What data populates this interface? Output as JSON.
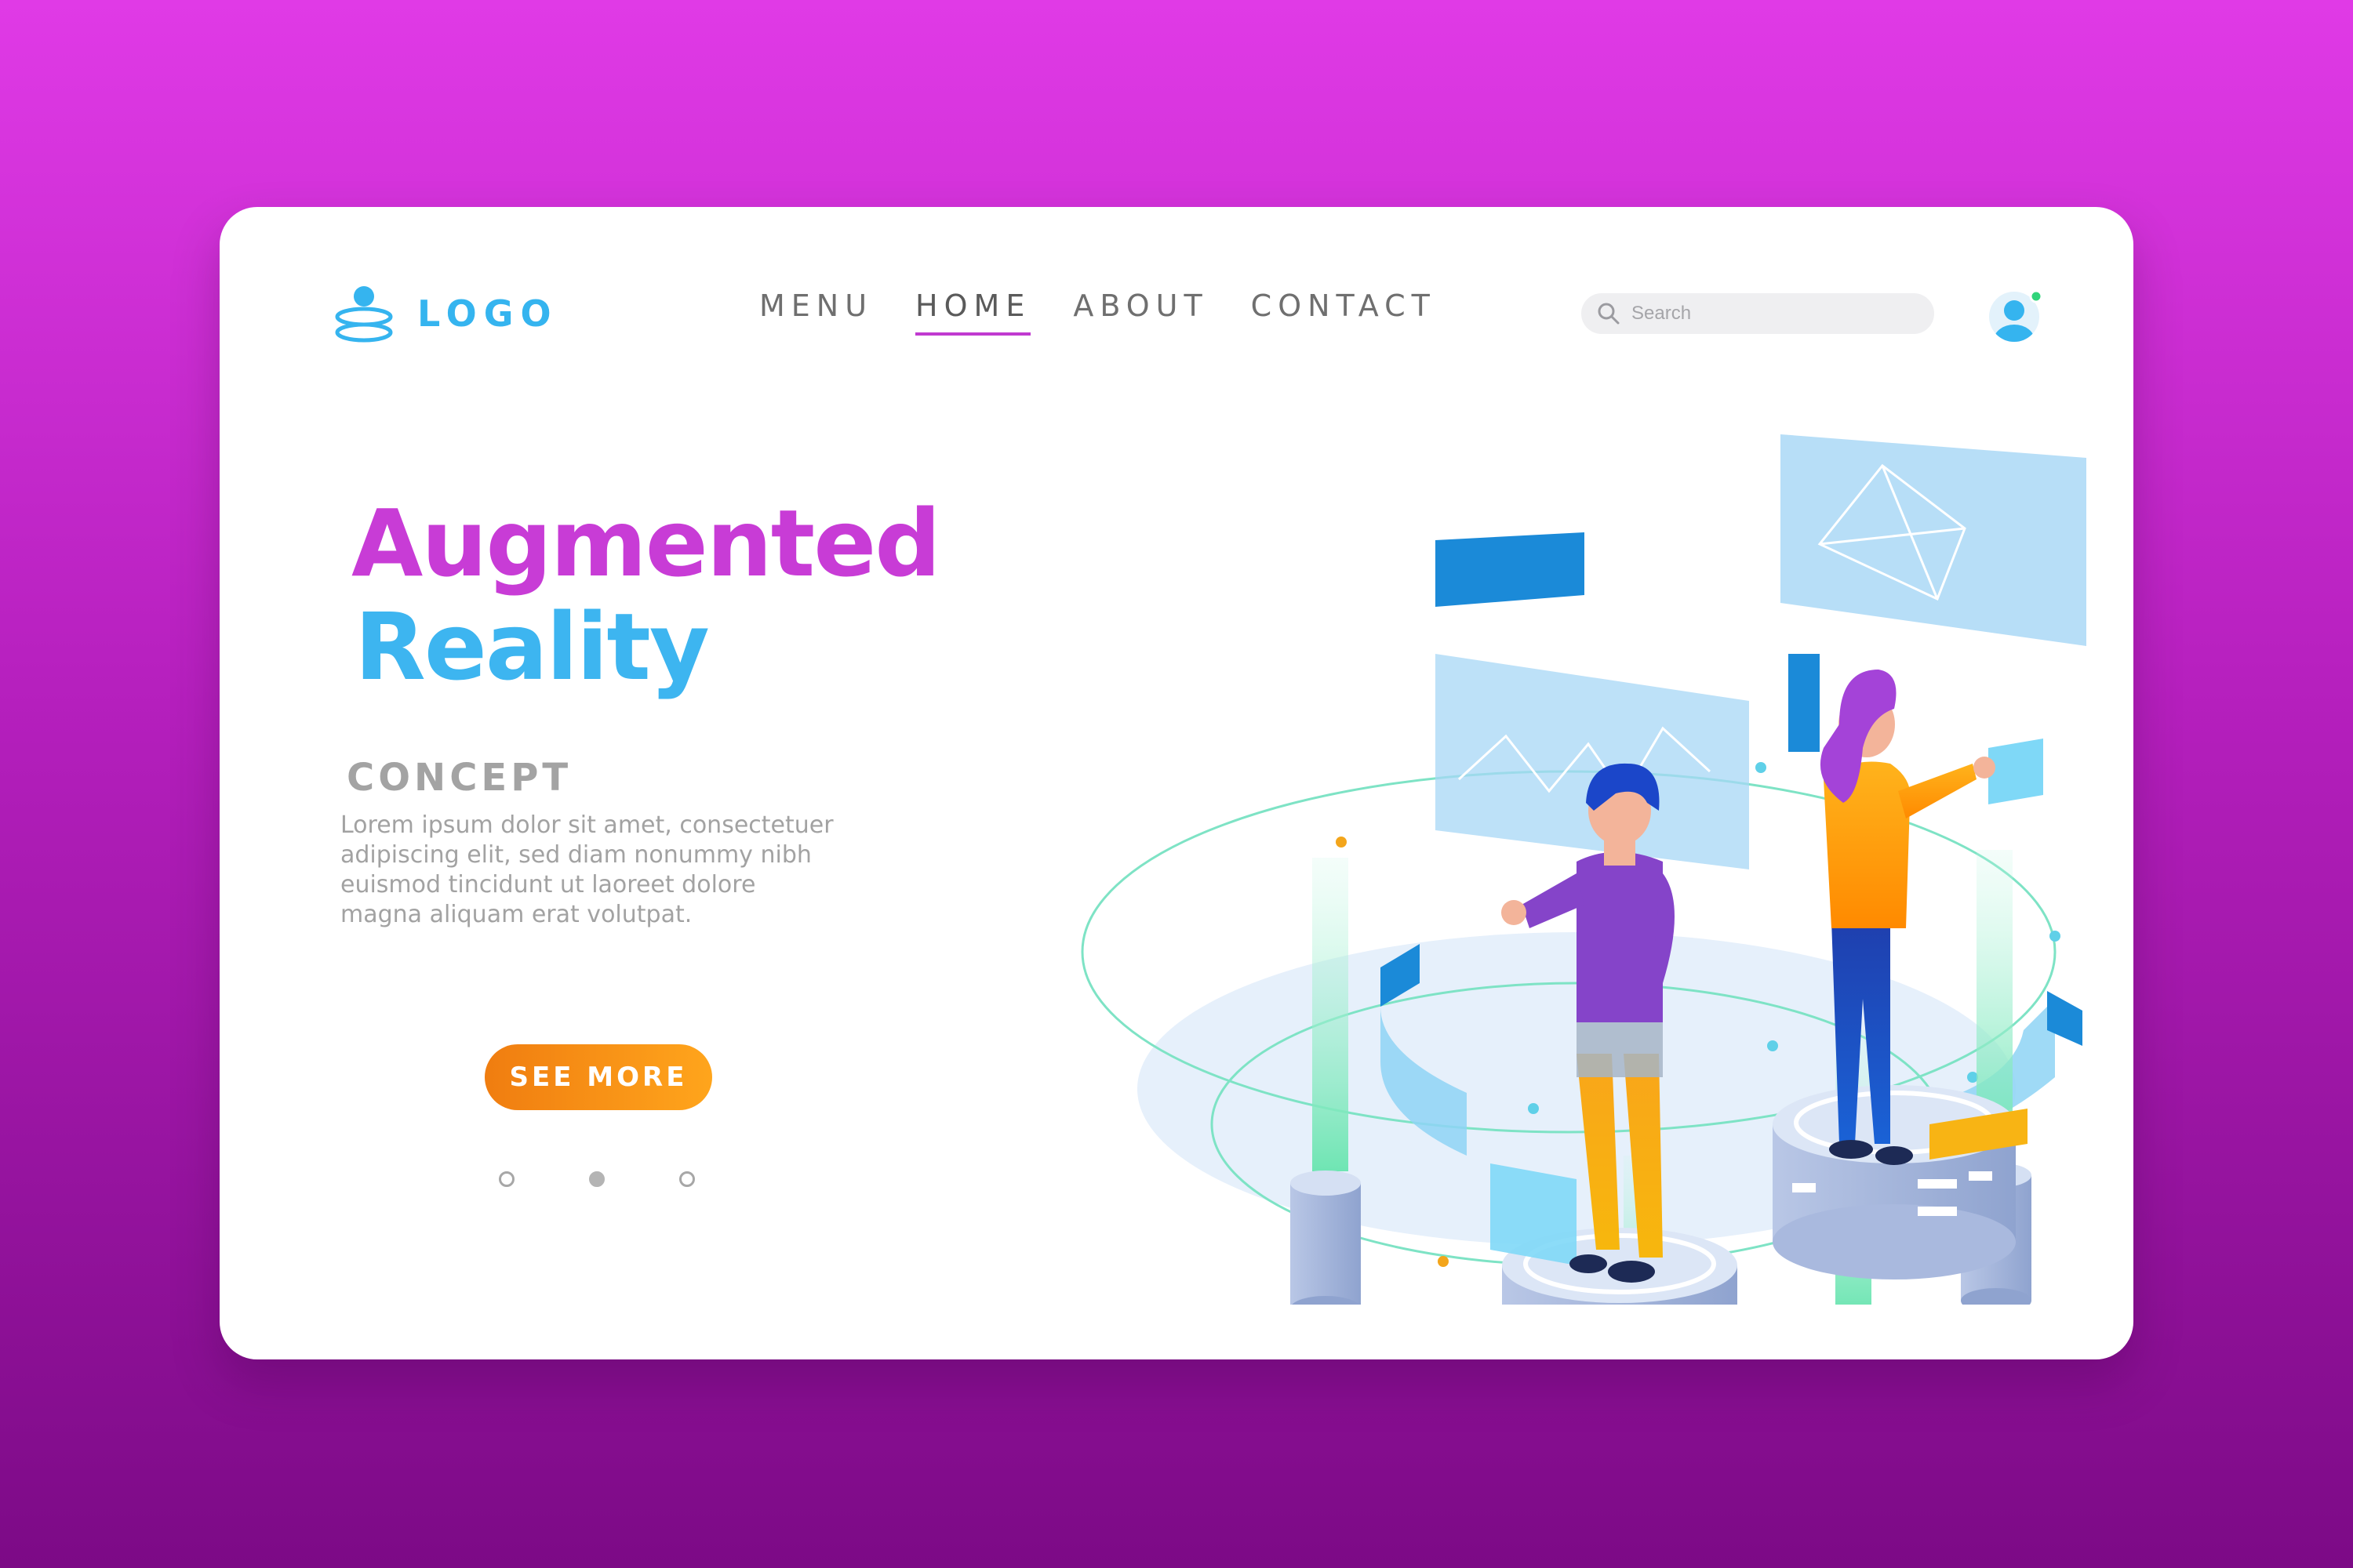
{
  "header": {
    "logo_text": "LOGO",
    "nav": [
      {
        "label": "MENU",
        "active": false
      },
      {
        "label": "HOME",
        "active": true
      },
      {
        "label": "ABOUT",
        "active": false
      },
      {
        "label": "CONTACT",
        "active": false
      }
    ],
    "search": {
      "placeholder": "Search",
      "value": ""
    },
    "avatar_status": "online"
  },
  "hero": {
    "title_line1": "Augmented",
    "title_line2": "Reality",
    "subtitle": "CONCEPT",
    "body_lines": [
      "Lorem ipsum dolor sit amet, consectetuer",
      "adipiscing elit, sed diam nonummy nibh",
      "euismod tincidunt ut laoreet dolore",
      "magna aliquam erat volutpat."
    ],
    "cta_label": "SEE MORE"
  },
  "carousel": {
    "count": 3,
    "active_index": 1
  },
  "colors": {
    "background_top": "#e03ae6",
    "background_bottom": "#7c0a86",
    "title_purple": "#c83cd6",
    "title_blue": "#3db5f0",
    "accent_orange": "#f58a12",
    "nav_underline": "#c03ad0",
    "status_green": "#31d47a"
  },
  "icons": {
    "logo": "person-hologram-icon",
    "search": "search-icon",
    "avatar": "user-avatar-icon"
  }
}
